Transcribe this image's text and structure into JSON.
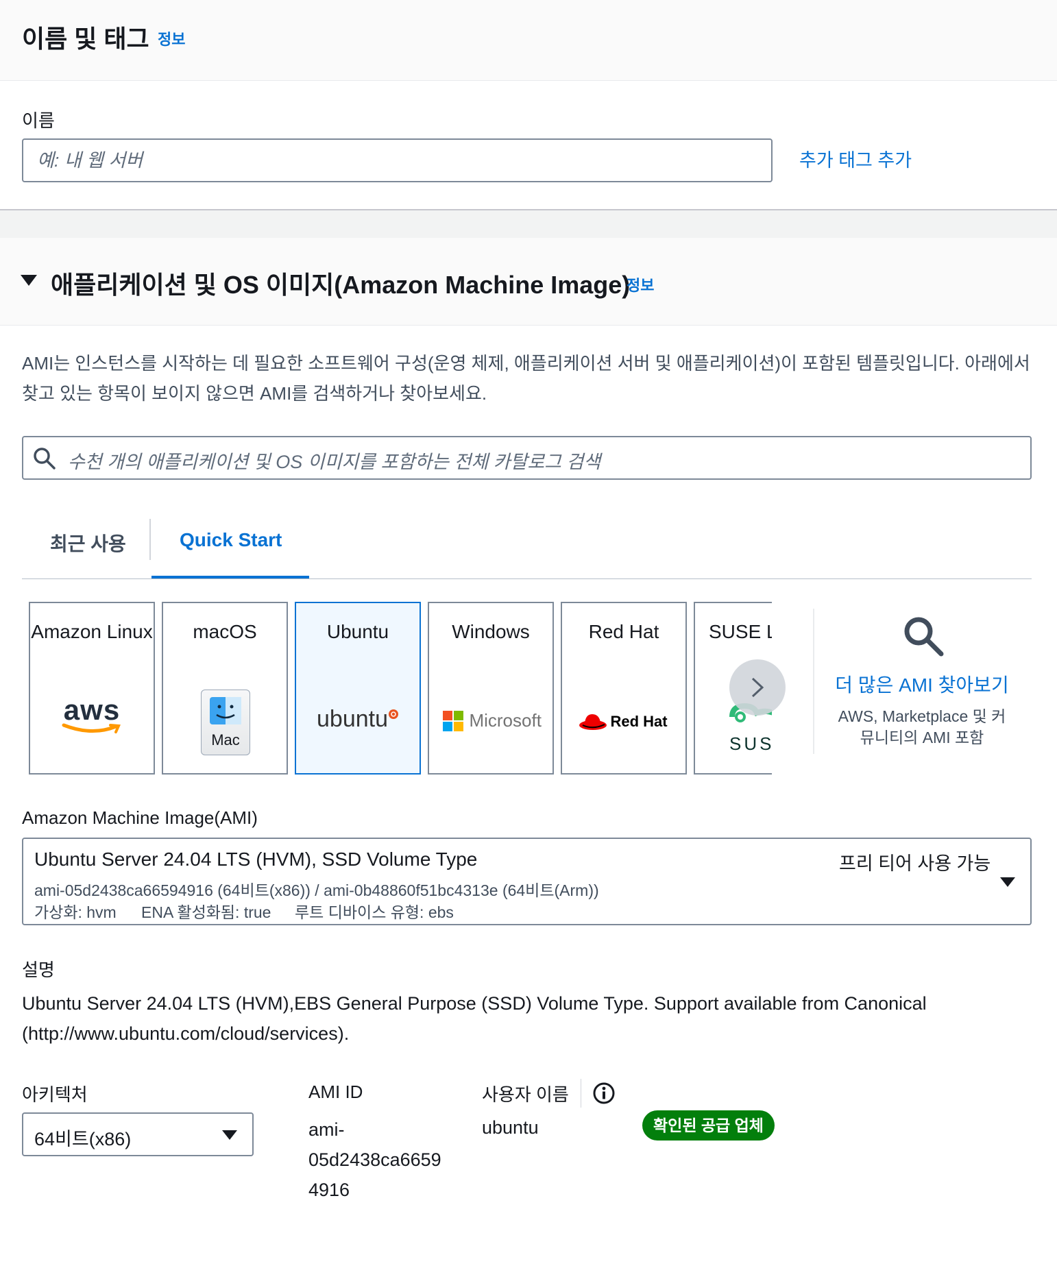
{
  "name_tags": {
    "title": "이름 및 태그",
    "info": "정보",
    "name_label": "이름",
    "name_placeholder": "예: 내 웹 서버",
    "add_tags": "추가 태그 추가"
  },
  "ami_section": {
    "title": "애플리케이션 및 OS 이미지(Amazon Machine Image)",
    "info": "정보",
    "description": "AMI는 인스턴스를 시작하는 데 필요한 소프트웨어 구성(운영 체제, 애플리케이션 서버 및 애플리케이션)이 포함된 템플릿입니다. 아래에서 찾고 있는 항목이 보이지 않으면 AMI를 검색하거나 찾아보세요.",
    "search_placeholder": "수천 개의 애플리케이션 및 OS 이미지를 포함하는 전체 카탈로그 검색",
    "tabs": [
      {
        "label": "최근 사용",
        "active": false
      },
      {
        "label": "Quick Start",
        "active": true
      }
    ],
    "os_cards": [
      {
        "name": "Amazon Linux",
        "logo_text": "aws",
        "icon": "aws-logo-icon"
      },
      {
        "name": "macOS",
        "logo_text": "Mac",
        "icon": "mac-finder-icon"
      },
      {
        "name": "Ubuntu",
        "logo_text": "ubuntu",
        "icon": "ubuntu-logo-icon",
        "selected": true
      },
      {
        "name": "Windows",
        "logo_text": "Microsoft",
        "icon": "microsoft-logo-icon"
      },
      {
        "name": "Red Hat",
        "logo_text": "Red Hat",
        "icon": "redhat-logo-icon"
      },
      {
        "name": "SUSE Li",
        "logo_text": "SUS",
        "icon": "suse-logo-icon"
      }
    ],
    "browse_more": {
      "title": "더 많은 AMI 찾아보기",
      "subtitle": "AWS, Marketplace 및 커뮤니티의 AMI 포함"
    },
    "ami_label": "Amazon Machine Image(AMI)",
    "selected_ami": {
      "name": "Ubuntu Server 24.04 LTS (HVM), SSD Volume Type",
      "ids": "ami-05d2438ca66594916 (64비트(x86)) / ami-0b48860f51bc4313e (64비트(Arm))",
      "virtualization": "가상화: hvm",
      "ena": "ENA 활성화됨: true",
      "root_device": "루트 디바이스 유형: ebs",
      "free_tier": "프리 티어 사용 가능"
    },
    "description_label": "설명",
    "ami_description": "Ubuntu Server 24.04 LTS (HVM),EBS General Purpose (SSD) Volume Type. Support available from Canonical (http://www.ubuntu.com/cloud/services).",
    "architecture_label": "아키텍처",
    "architecture_value": "64비트(x86)",
    "ami_id_label": "AMI ID",
    "ami_id_lines": [
      "ami-",
      "05d2438ca6659",
      "4916"
    ],
    "username_label": "사용자 이름",
    "username_value": "ubuntu",
    "verified_badge": "확인된 공급 업체"
  },
  "colors": {
    "link": "#0972d3",
    "selected_border": "#0972d3",
    "badge_green": "#037f0c"
  }
}
